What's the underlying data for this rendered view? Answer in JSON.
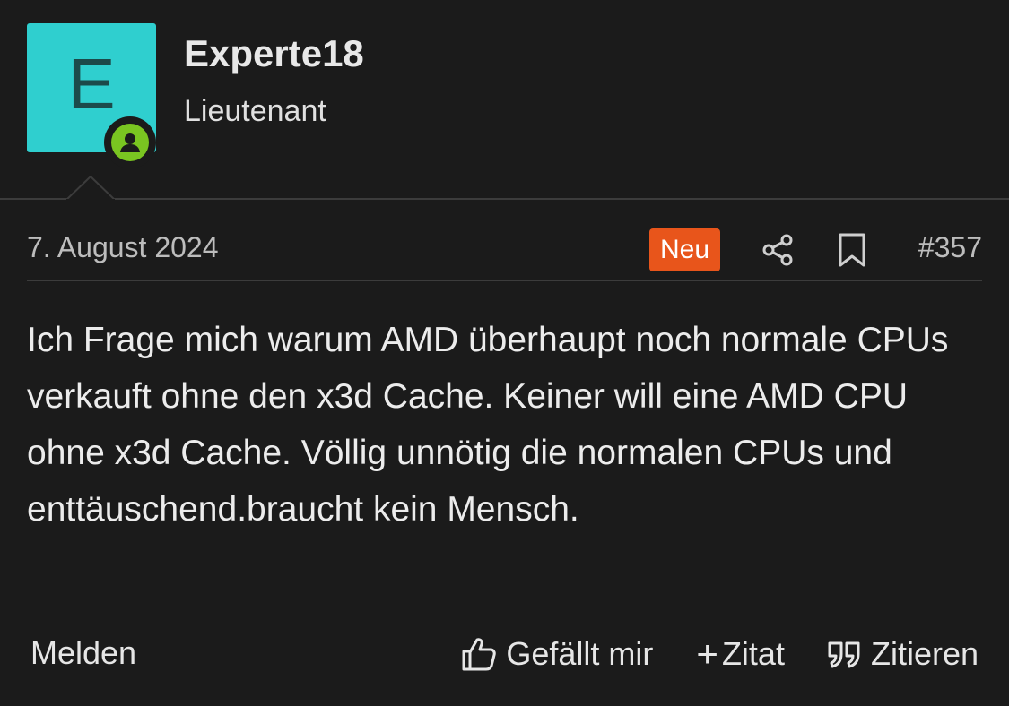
{
  "author": {
    "avatar_letter": "E",
    "avatar_color": "#2fcfcf",
    "online_color": "#7ac521",
    "name": "Experte18",
    "rank": "Lieutenant"
  },
  "post": {
    "date": "7. August 2024",
    "new_badge": "Neu",
    "new_badge_color": "#e8551b",
    "number": "#357",
    "body": "Ich Frage mich warum AMD überhaupt noch normale CPUs verkauft ohne den x3d Cache. Keiner will eine AMD CPU ohne x3d Cache. Völlig unnötig die normalen CPUs und enttäuschend.braucht kein Mensch."
  },
  "actions": {
    "report": "Melden",
    "like": "Gefällt mir",
    "quote_add": "Zitat",
    "quote": "Zitieren"
  },
  "icons": {
    "share": "share-icon",
    "bookmark": "bookmark-icon",
    "like": "thumbs-up-icon",
    "quote_add": "plus-icon",
    "quote": "quote-icon",
    "online": "user-online-icon"
  }
}
